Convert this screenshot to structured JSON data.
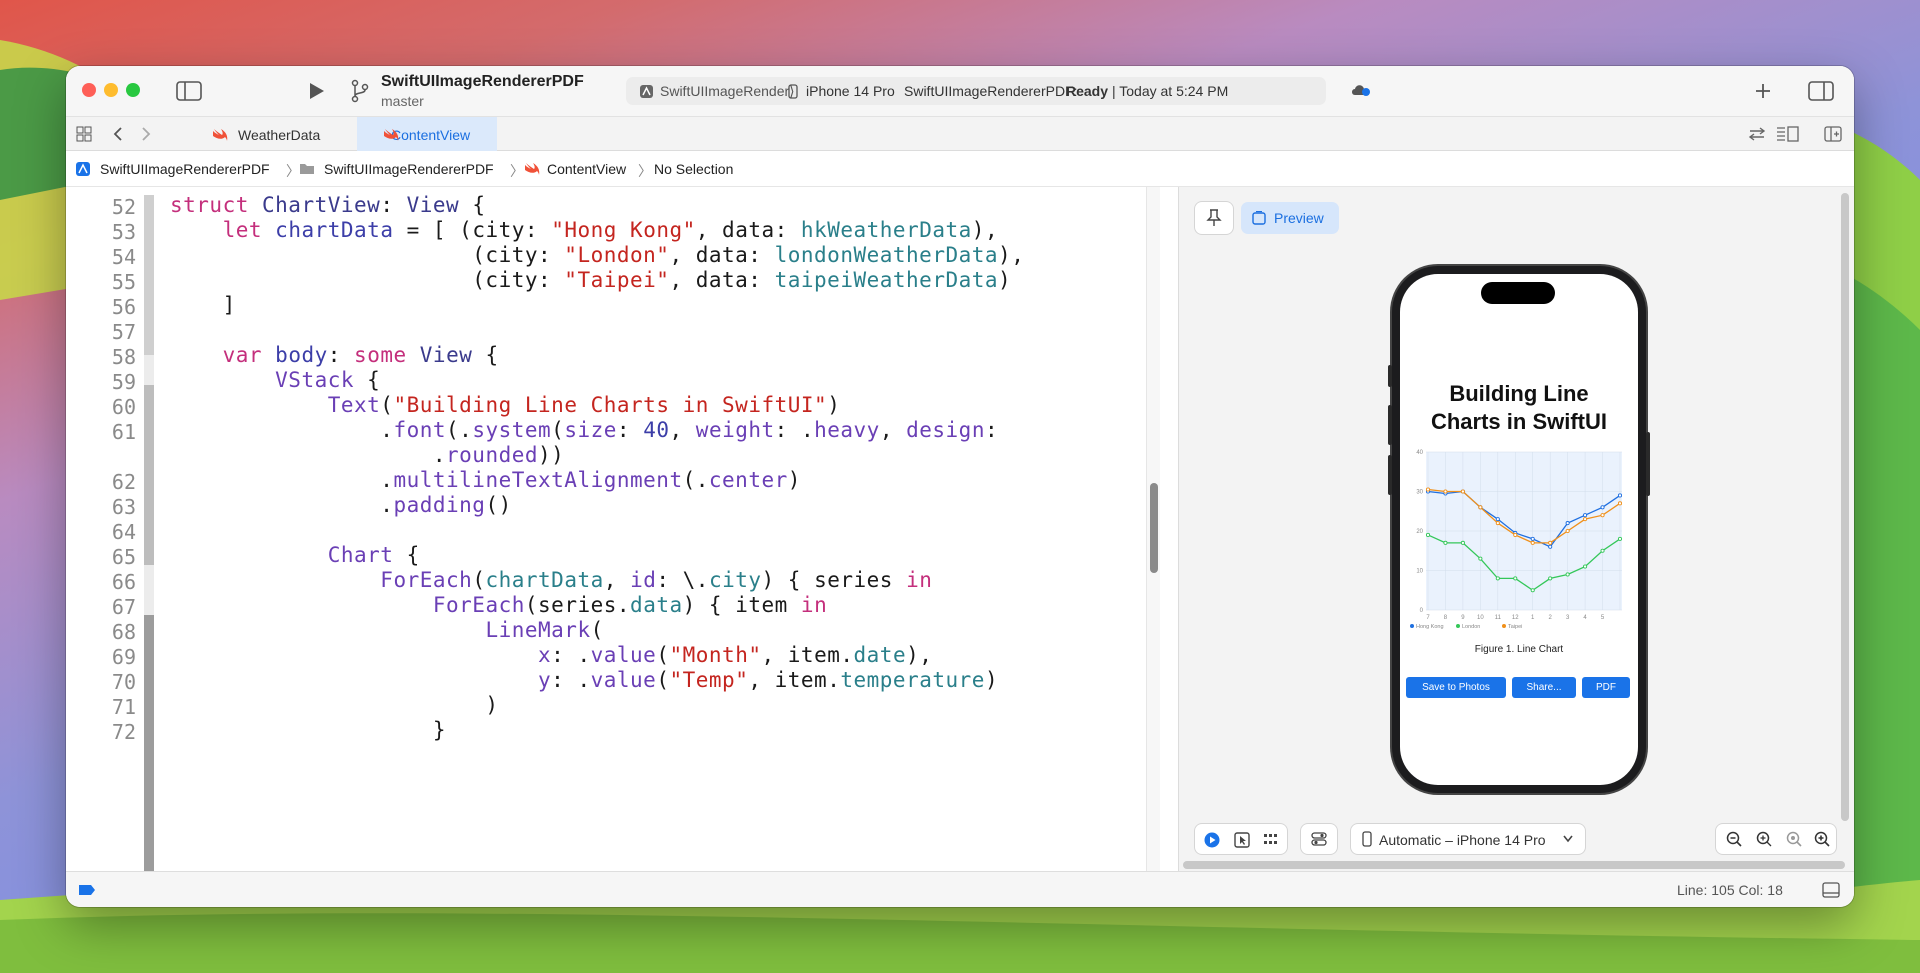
{
  "titlebar": {
    "project": "SwiftUIImageRendererPDF",
    "branch": "master",
    "scheme": "SwiftUIImageRender⟩",
    "device": "iPhone 14 Pro",
    "status_prefix": "SwiftUIImageRendererPDF:",
    "status_state": "Ready",
    "status_time": "| Today at 5:24 PM"
  },
  "tabs": [
    {
      "label": "WeatherData"
    },
    {
      "label": "ContentView"
    }
  ],
  "breadcrumbs": [
    "SwiftUIImageRendererPDF",
    "SwiftUIImageRendererPDF",
    "ContentView",
    "No Selection"
  ],
  "code": {
    "line_numbers": [
      "52",
      "53",
      "54",
      "55",
      "56",
      "57",
      "58",
      "59",
      "60",
      "61",
      "",
      "62",
      "63",
      "64",
      "65",
      "66",
      "67",
      "68",
      "69",
      "70",
      "71",
      "72"
    ]
  },
  "preview": {
    "preview_label": "Preview",
    "app_title_line1": "Building Line",
    "app_title_line2": "Charts in SwiftUI",
    "figure_caption": "Figure 1. Line Chart",
    "buttons": [
      "Save to Photos",
      "Share...",
      "PDF"
    ],
    "device_selector": "Automatic – iPhone 14 Pro"
  },
  "status": {
    "line_col": "Line: 105  Col: 18"
  },
  "chart_data": {
    "type": "line",
    "ylim": [
      0,
      40
    ],
    "yticks": [
      "0",
      "10",
      "20",
      "30",
      "40"
    ],
    "categories": [
      "7",
      "8",
      "9",
      "10",
      "11",
      "12",
      "1",
      "2",
      "3",
      "4",
      "5"
    ],
    "series": [
      {
        "name": "Hong Kong",
        "color": "#1f6fe0",
        "values": [
          30,
          29.5,
          30,
          26,
          23,
          19.5,
          18,
          16,
          22,
          24,
          26,
          29
        ]
      },
      {
        "name": "London",
        "color": "#34c759",
        "values": [
          19,
          17,
          17,
          13,
          8,
          8,
          5,
          8,
          9,
          11,
          15,
          18
        ]
      },
      {
        "name": "Taipei",
        "color": "#f0901a",
        "values": [
          30.5,
          30,
          30,
          26,
          22,
          19,
          17,
          17,
          20,
          23,
          24,
          27
        ]
      }
    ]
  }
}
